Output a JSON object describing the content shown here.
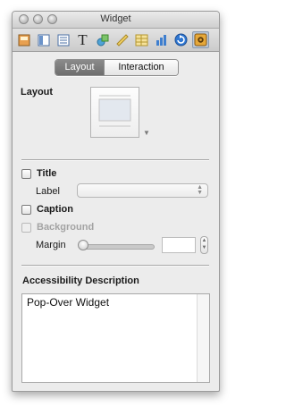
{
  "window": {
    "title": "Widget"
  },
  "toolbar": {
    "icons": [
      "widget-inspector-icon",
      "layout-inspector-icon",
      "list-inspector-icon",
      "text-inspector-icon",
      "graphic-inspector-icon",
      "metrics-inspector-icon",
      "table-inspector-icon",
      "chart-inspector-icon",
      "link-inspector-icon",
      "settings-inspector-icon"
    ],
    "selected": "settings-inspector-icon",
    "text_icon_glyph": "T"
  },
  "tabs": {
    "layout": "Layout",
    "interaction": "Interaction",
    "active": "Layout"
  },
  "layout_section": {
    "heading": "Layout"
  },
  "title_option": {
    "label": "Title",
    "checked": false
  },
  "label_field": {
    "label": "Label",
    "value": ""
  },
  "caption_option": {
    "label": "Caption",
    "checked": false
  },
  "background_option": {
    "label": "Background",
    "checked": false,
    "enabled": false
  },
  "margin": {
    "label": "Margin",
    "value": "",
    "slider_value": 0
  },
  "accessibility": {
    "heading": "Accessibility Description",
    "text": "Pop-Over Widget"
  }
}
